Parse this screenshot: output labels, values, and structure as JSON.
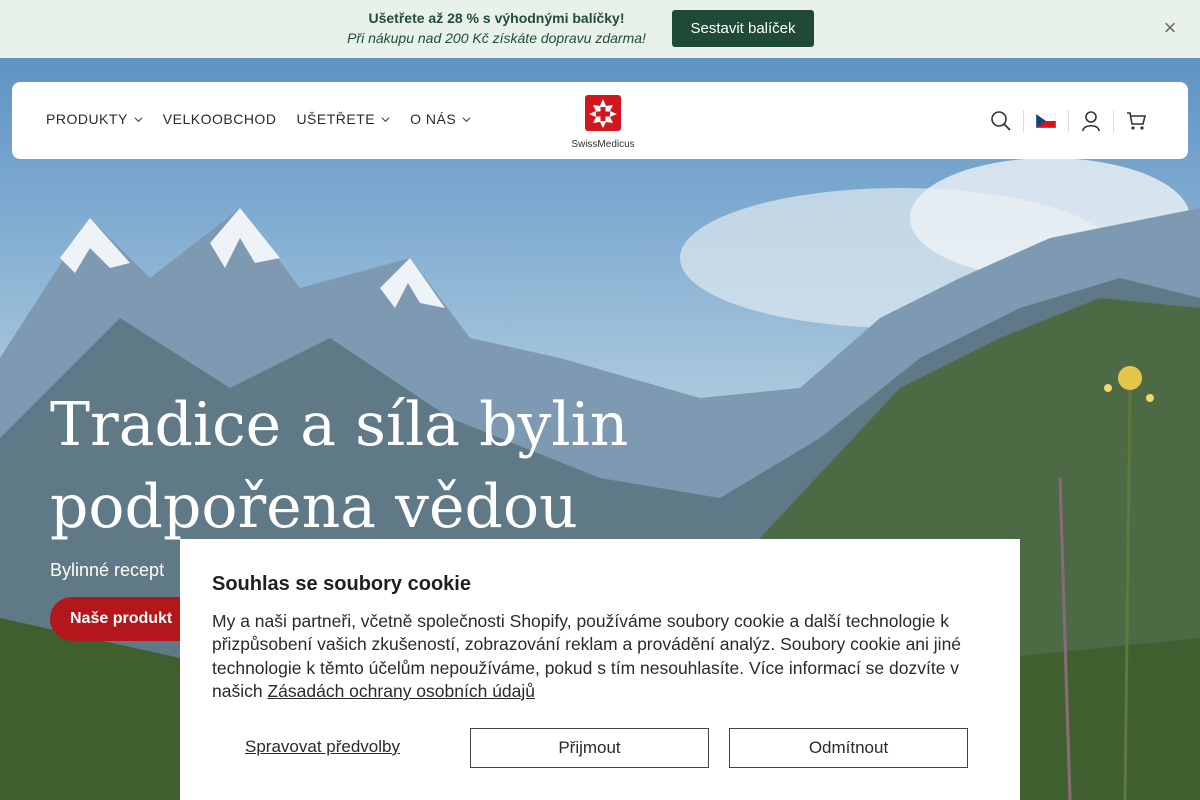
{
  "announcement": {
    "headline": "Ušetřete až 28 % s výhodnými balíčky!",
    "subline": "Při nákupu nad 200 Kč získáte dopravu zdarma!",
    "button_label": "Sestavit balíček",
    "close_icon": "×"
  },
  "nav": {
    "items": [
      {
        "label": "PRODUKTY",
        "has_dropdown": true
      },
      {
        "label": "VELKOOBCHOD",
        "has_dropdown": false
      },
      {
        "label": "UŠETŘETE",
        "has_dropdown": true
      },
      {
        "label": "O NÁS",
        "has_dropdown": true
      }
    ]
  },
  "brand": {
    "logo_text": "SwissMedicus",
    "logo_color": "#d1161d"
  },
  "header_icons": [
    "search-icon",
    "czech-flag-icon",
    "account-icon",
    "cart-icon"
  ],
  "hero": {
    "title_line1": "Tradice a síla bylin",
    "title_line2": "podpořena vědou",
    "subtitle": "Bylinné recept",
    "cta_label": "Naše produkt"
  },
  "cookie": {
    "title": "Souhlas se soubory cookie",
    "body": "My a naši partneři, včetně společnosti Shopify, používáme soubory cookie a další technologie k přizpůsobení vašich zkušeností, zobrazování reklam a provádění analýz. Soubory cookie ani jiné technologie k těmto účelům nepoužíváme, pokud s tím nesouhlasíte. Více informací se dozvíte v našich",
    "policy_link": "Zásadách ochrany osobních údajů",
    "manage_label": "Spravovat předvolby",
    "accept_label": "Přijmout",
    "decline_label": "Odmítnout"
  },
  "colors": {
    "announcement_bg": "#e9f1eb",
    "primary_green": "#1e4a36",
    "brand_red": "#b3171b"
  }
}
